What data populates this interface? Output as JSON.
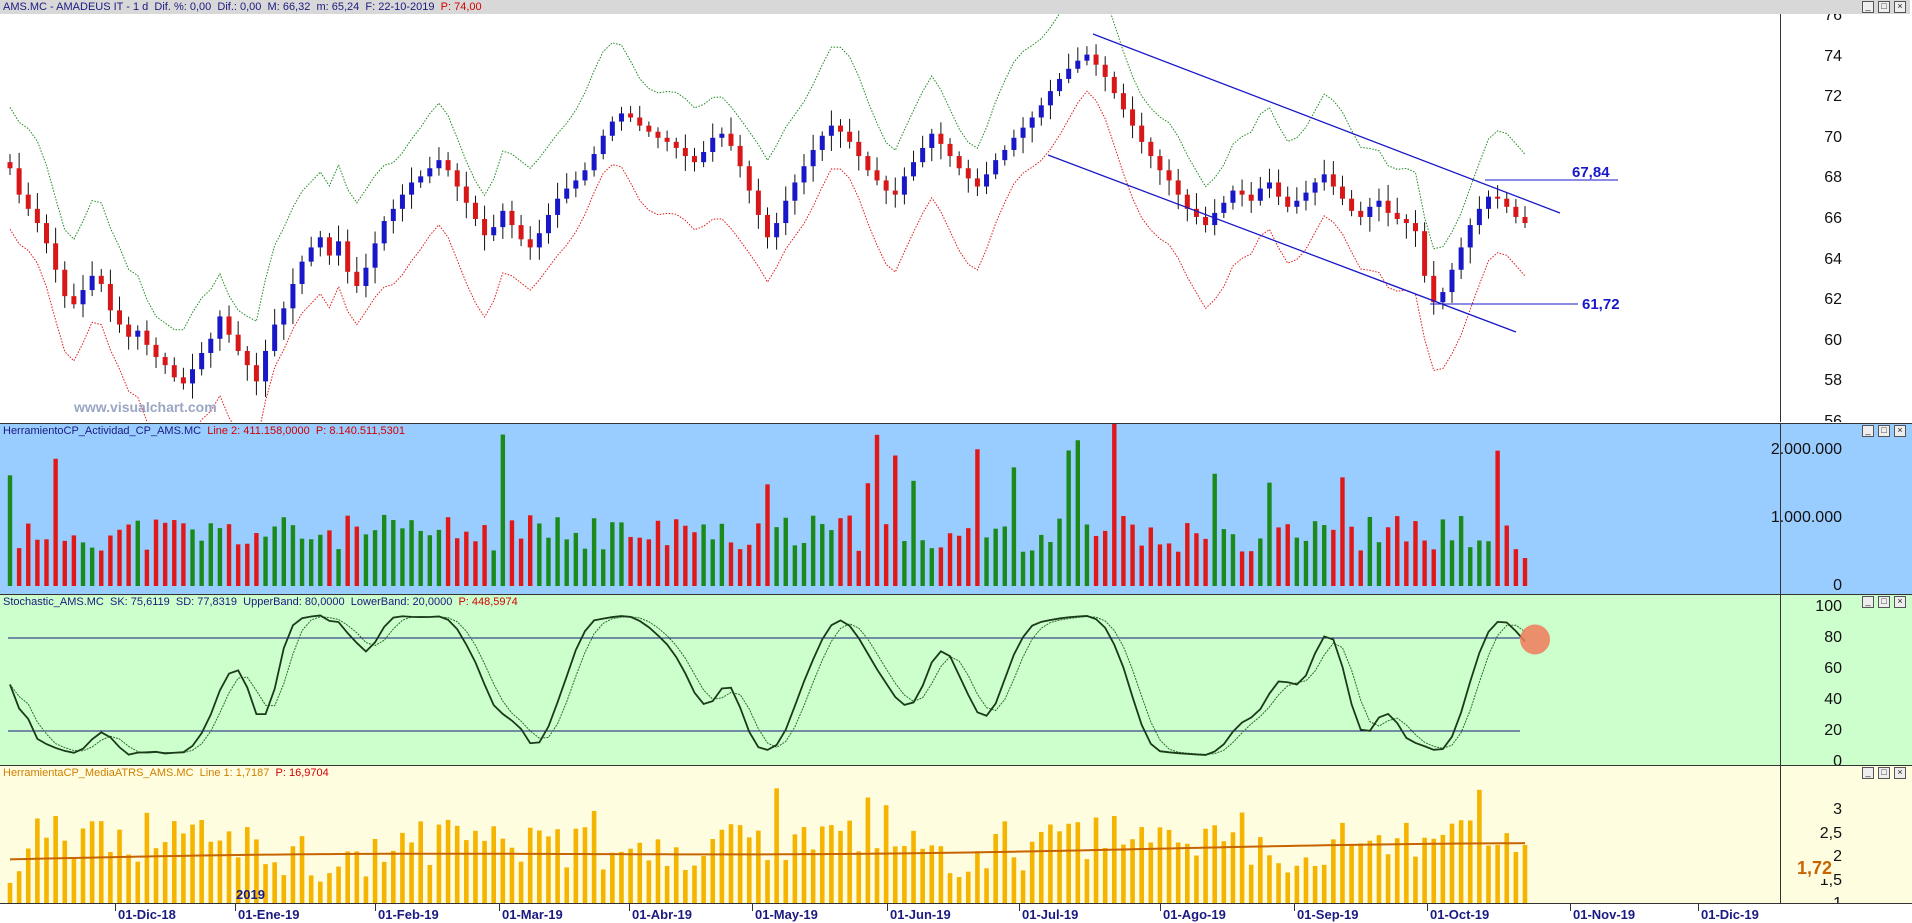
{
  "colors": {
    "up": "#1818c8",
    "down": "#d81818",
    "wick": "#111",
    "green": "#1b8a1b",
    "red": "#e01818",
    "channel": "#1818c8",
    "stoch": "#1a3a1a",
    "atr": "#f5b400",
    "atrline": "#c86400"
  },
  "price_panel": {
    "header": {
      "symbol": "AMS.MC - AMADEUS IT -  1 d",
      "dif_pct": "Dif. %: 0,00",
      "dif": "Dif.: 0,00",
      "max": "M: 66,32",
      "min": "m: 65,24",
      "date": "F: 22-10-2019",
      "price": "P: 74,00"
    },
    "watermark": "www.visualchart.com",
    "annotations": {
      "upper": "67,84",
      "lower": "61,72"
    },
    "ticks": [
      "56",
      "58",
      "60",
      "62",
      "64",
      "66",
      "68",
      "70",
      "72",
      "74",
      "76"
    ]
  },
  "volume_panel": {
    "header": {
      "name": "HerramientoCP_Actividad_CP_AMS.MC",
      "line2": "Line 2: 411.158,0000",
      "p": "P: 8.140.511,5301"
    },
    "ticks": [
      "0",
      "1.000.000",
      "2.000.000"
    ]
  },
  "stoch_panel": {
    "header": {
      "name": "Stochastic_AMS.MC",
      "sk": "SK: 75,6119",
      "sd": "SD: 77,8319",
      "upper": "UpperBand: 80,0000",
      "lower": "LowerBand: 20,0000",
      "p": "P: 448,5974"
    },
    "ticks": [
      "0",
      "20",
      "40",
      "60",
      "80",
      "100"
    ]
  },
  "atr_panel": {
    "header": {
      "name": "HerramientaCP_MediaATRS_AMS.MC",
      "line1": "Line 1: 1,7187",
      "p": "P: 16,9704"
    },
    "ticks": [
      "1",
      "1,5",
      "2",
      "2,5",
      "3"
    ],
    "current": "1,72",
    "year_marker": "2019"
  },
  "dates": [
    "01-Dic-18",
    "01-Ene-19",
    "01-Feb-19",
    "01-Mar-19",
    "01-Abr-19",
    "01-May-19",
    "01-Jun-19",
    "01-Jul-19",
    "01-Ago-19",
    "01-Sep-19",
    "01-Oct-19",
    "01-Nov-19",
    "01-Dic-19"
  ],
  "chart_data": [
    {
      "type": "candlestick",
      "title": "AMS.MC - AMADEUS IT - 1 d",
      "ylim": [
        56,
        76
      ],
      "x_range": [
        "2018-11-21",
        "2019-10-22"
      ],
      "closes": [
        68.5,
        67.2,
        66.5,
        65.8,
        64.8,
        63.5,
        62.2,
        61.8,
        62.5,
        63.2,
        62.8,
        61.5,
        60.8,
        60.2,
        60.5,
        59.8,
        59.2,
        58.8,
        58.2,
        57.9,
        58.6,
        59.4,
        60.1,
        61.2,
        60.3,
        59.5,
        58.8,
        58.0,
        59.5,
        60.8,
        61.6,
        62.8,
        63.9,
        64.6,
        65.1,
        64.2,
        64.9,
        63.4,
        62.7,
        63.6,
        64.8,
        65.9,
        66.5,
        67.2,
        67.8,
        68.1,
        68.5,
        68.9,
        68.4,
        67.6,
        66.8,
        66.0,
        65.2,
        65.6,
        66.4,
        65.7,
        65.0,
        64.6,
        65.3,
        66.2,
        67.0,
        67.5,
        67.9,
        68.4,
        69.2,
        70.1,
        70.8,
        71.2,
        71.0,
        70.6,
        70.3,
        70.0,
        69.8,
        69.5,
        69.1,
        68.8,
        69.3,
        70.0,
        70.2,
        69.6,
        68.6,
        67.4,
        66.2,
        65.1,
        65.8,
        66.9,
        67.8,
        68.6,
        69.4,
        70.1,
        70.6,
        70.3,
        69.8,
        69.1,
        68.4,
        67.9,
        67.4,
        67.2,
        68.1,
        68.8,
        69.5,
        70.2,
        69.7,
        69.1,
        68.5,
        68.0,
        67.6,
        68.2,
        68.9,
        69.4,
        70.0,
        70.5,
        71.0,
        71.6,
        72.3,
        72.9,
        73.4,
        73.8,
        74.1,
        73.6,
        73.0,
        72.2,
        71.4,
        70.6,
        69.8,
        69.1,
        68.4,
        67.9,
        67.2,
        66.5,
        66.1,
        65.7,
        66.3,
        66.8,
        67.4,
        67.2,
        66.9,
        67.5,
        67.8,
        67.1,
        66.6,
        66.9,
        67.3,
        67.8,
        68.2,
        67.6,
        67.0,
        66.4,
        66.1,
        66.6,
        66.9,
        66.3,
        66.0,
        65.8,
        65.4,
        63.2,
        61.9,
        62.4,
        63.5,
        64.6,
        65.7,
        66.5,
        67.1,
        67.0,
        66.6,
        66.1,
        65.8
      ]
    }
  ]
}
